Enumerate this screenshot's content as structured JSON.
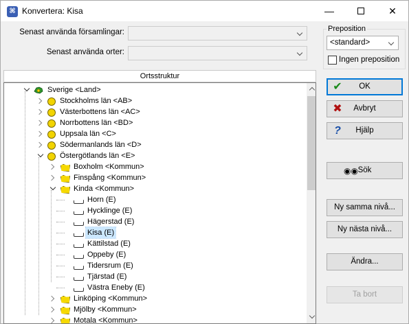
{
  "window": {
    "title": "Konvertera: Kisa",
    "icon": "app-icon",
    "minimize": "—",
    "close": "✕"
  },
  "combos": {
    "forsamlingar_label": "Senast använda församlingar:",
    "orter_label": "Senast använda orter:",
    "forsamlingar_value": "",
    "orter_value": ""
  },
  "preposition": {
    "group_label": "Preposition",
    "selected": "<standard>",
    "ingen_label": "Ingen preposition",
    "ingen_checked": false
  },
  "tree": {
    "header": "Ortsstruktur",
    "rows": [
      {
        "label": "Sverige <Land>",
        "type": "land",
        "expand": "open",
        "level": 0
      },
      {
        "label": "Stockholms län <AB>",
        "type": "lan",
        "expand": "closed",
        "level": 1
      },
      {
        "label": "Västerbottens län <AC>",
        "type": "lan",
        "expand": "closed",
        "level": 1
      },
      {
        "label": "Norrbottens län <BD>",
        "type": "lan",
        "expand": "closed",
        "level": 1
      },
      {
        "label": "Uppsala län <C>",
        "type": "lan",
        "expand": "closed",
        "level": 1
      },
      {
        "label": "Södermanlands län <D>",
        "type": "lan",
        "expand": "closed",
        "level": 1
      },
      {
        "label": "Östergötlands län <E>",
        "type": "lan",
        "expand": "open",
        "level": 1
      },
      {
        "label": "Boxholm <Kommun>",
        "type": "kommun",
        "expand": "closed",
        "level": 2
      },
      {
        "label": "Finspång <Kommun>",
        "type": "kommun",
        "expand": "closed",
        "level": 2
      },
      {
        "label": "Kinda <Kommun>",
        "type": "kommun",
        "expand": "open",
        "level": 2
      },
      {
        "label": "Horn (E)",
        "type": "forsamling",
        "expand": "none",
        "level": 3
      },
      {
        "label": "Hycklinge (E)",
        "type": "forsamling",
        "expand": "none",
        "level": 3
      },
      {
        "label": "Hägerstad (E)",
        "type": "forsamling",
        "expand": "none",
        "level": 3
      },
      {
        "label": "Kisa (E)",
        "type": "forsamling",
        "expand": "none",
        "level": 3,
        "selected": true
      },
      {
        "label": "Kättilstad (E)",
        "type": "forsamling",
        "expand": "none",
        "level": 3
      },
      {
        "label": "Oppeby (E)",
        "type": "forsamling",
        "expand": "none",
        "level": 3
      },
      {
        "label": "Tidersrum (E)",
        "type": "forsamling",
        "expand": "none",
        "level": 3
      },
      {
        "label": "Tjärstad (E)",
        "type": "forsamling",
        "expand": "none",
        "level": 3
      },
      {
        "label": "Västra Eneby (E)",
        "type": "forsamling",
        "expand": "none",
        "level": 3
      },
      {
        "label": "Linköping <Kommun>",
        "type": "kommun",
        "expand": "closed",
        "level": 2
      },
      {
        "label": "Mjölby <Kommun>",
        "type": "kommun",
        "expand": "closed",
        "level": 2
      },
      {
        "label": "Motala <Kommun>",
        "type": "kommun",
        "expand": "closed",
        "level": 2
      }
    ]
  },
  "buttons": {
    "ok": "OK",
    "avbryt": "Avbryt",
    "hjalp": "Hjälp",
    "sok": "Sök",
    "ny_samma": "Ny samma nivå...",
    "ny_nasta": "Ny nästa nivå...",
    "andra": "Ändra...",
    "ta_bort": "Ta bort"
  },
  "colors": {
    "ok_icon": "#1a8a1a",
    "avbryt_icon": "#b01010",
    "hjalp_icon": "#1a4fa8",
    "selection": "#cce8ff",
    "default_button_border": "#0078d7"
  }
}
